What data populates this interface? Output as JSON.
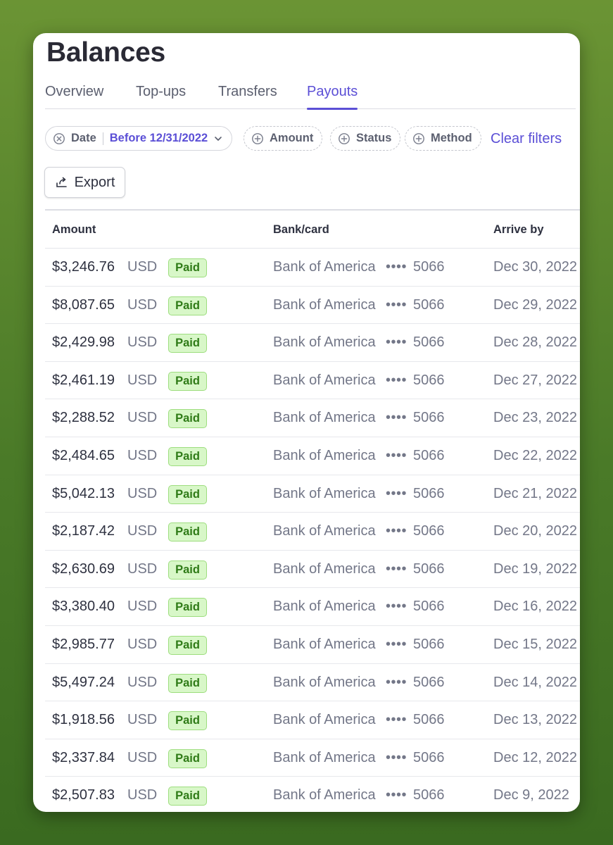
{
  "page": {
    "title": "Balances"
  },
  "tabs": [
    {
      "label": "Overview",
      "active": false
    },
    {
      "label": "Top-ups",
      "active": false
    },
    {
      "label": "Transfers",
      "active": false
    },
    {
      "label": "Payouts",
      "active": true
    }
  ],
  "filters": {
    "date": {
      "label": "Date",
      "value": "Before 12/31/2022",
      "icon": "clear-circle-x-icon"
    },
    "amount": {
      "label": "Amount",
      "icon": "plus-circle-icon"
    },
    "status": {
      "label": "Status",
      "icon": "plus-circle-icon"
    },
    "method": {
      "label": "Method",
      "icon": "plus-circle-icon"
    },
    "clear_label": "Clear filters"
  },
  "toolbar": {
    "export_label": "Export",
    "export_icon": "export-icon"
  },
  "table": {
    "columns": [
      "Amount",
      "Bank/card",
      "Arrive by"
    ],
    "rows": [
      {
        "amount": "$3,246.76",
        "currency": "USD",
        "status": "Paid",
        "bank": "Bank of America",
        "dots": "••••",
        "last4": "5066",
        "arrive": "Dec 30, 2022"
      },
      {
        "amount": "$8,087.65",
        "currency": "USD",
        "status": "Paid",
        "bank": "Bank of America",
        "dots": "••••",
        "last4": "5066",
        "arrive": "Dec 29, 2022"
      },
      {
        "amount": "$2,429.98",
        "currency": "USD",
        "status": "Paid",
        "bank": "Bank of America",
        "dots": "••••",
        "last4": "5066",
        "arrive": "Dec 28, 2022"
      },
      {
        "amount": "$2,461.19",
        "currency": "USD",
        "status": "Paid",
        "bank": "Bank of America",
        "dots": "••••",
        "last4": "5066",
        "arrive": "Dec 27, 2022"
      },
      {
        "amount": "$2,288.52",
        "currency": "USD",
        "status": "Paid",
        "bank": "Bank of America",
        "dots": "••••",
        "last4": "5066",
        "arrive": "Dec 23, 2022"
      },
      {
        "amount": "$2,484.65",
        "currency": "USD",
        "status": "Paid",
        "bank": "Bank of America",
        "dots": "••••",
        "last4": "5066",
        "arrive": "Dec 22, 2022"
      },
      {
        "amount": "$5,042.13",
        "currency": "USD",
        "status": "Paid",
        "bank": "Bank of America",
        "dots": "••••",
        "last4": "5066",
        "arrive": "Dec 21, 2022"
      },
      {
        "amount": "$2,187.42",
        "currency": "USD",
        "status": "Paid",
        "bank": "Bank of America",
        "dots": "••••",
        "last4": "5066",
        "arrive": "Dec 20, 2022"
      },
      {
        "amount": "$2,630.69",
        "currency": "USD",
        "status": "Paid",
        "bank": "Bank of America",
        "dots": "••••",
        "last4": "5066",
        "arrive": "Dec 19, 2022"
      },
      {
        "amount": "$3,380.40",
        "currency": "USD",
        "status": "Paid",
        "bank": "Bank of America",
        "dots": "••••",
        "last4": "5066",
        "arrive": "Dec 16, 2022"
      },
      {
        "amount": "$2,985.77",
        "currency": "USD",
        "status": "Paid",
        "bank": "Bank of America",
        "dots": "••••",
        "last4": "5066",
        "arrive": "Dec 15, 2022"
      },
      {
        "amount": "$5,497.24",
        "currency": "USD",
        "status": "Paid",
        "bank": "Bank of America",
        "dots": "••••",
        "last4": "5066",
        "arrive": "Dec 14, 2022"
      },
      {
        "amount": "$1,918.56",
        "currency": "USD",
        "status": "Paid",
        "bank": "Bank of America",
        "dots": "••••",
        "last4": "5066",
        "arrive": "Dec 13, 2022"
      },
      {
        "amount": "$2,337.84",
        "currency": "USD",
        "status": "Paid",
        "bank": "Bank of America",
        "dots": "••••",
        "last4": "5066",
        "arrive": "Dec 12, 2022"
      },
      {
        "amount": "$2,507.83",
        "currency": "USD",
        "status": "Paid",
        "bank": "Bank of America",
        "dots": "••••",
        "last4": "5066",
        "arrive": "Dec 9, 2022"
      }
    ]
  },
  "colors": {
    "accent": "#5b4fd6",
    "paid_bg": "#d8f7c8",
    "paid_text": "#2f7b17",
    "background": "#5a8a2c"
  }
}
